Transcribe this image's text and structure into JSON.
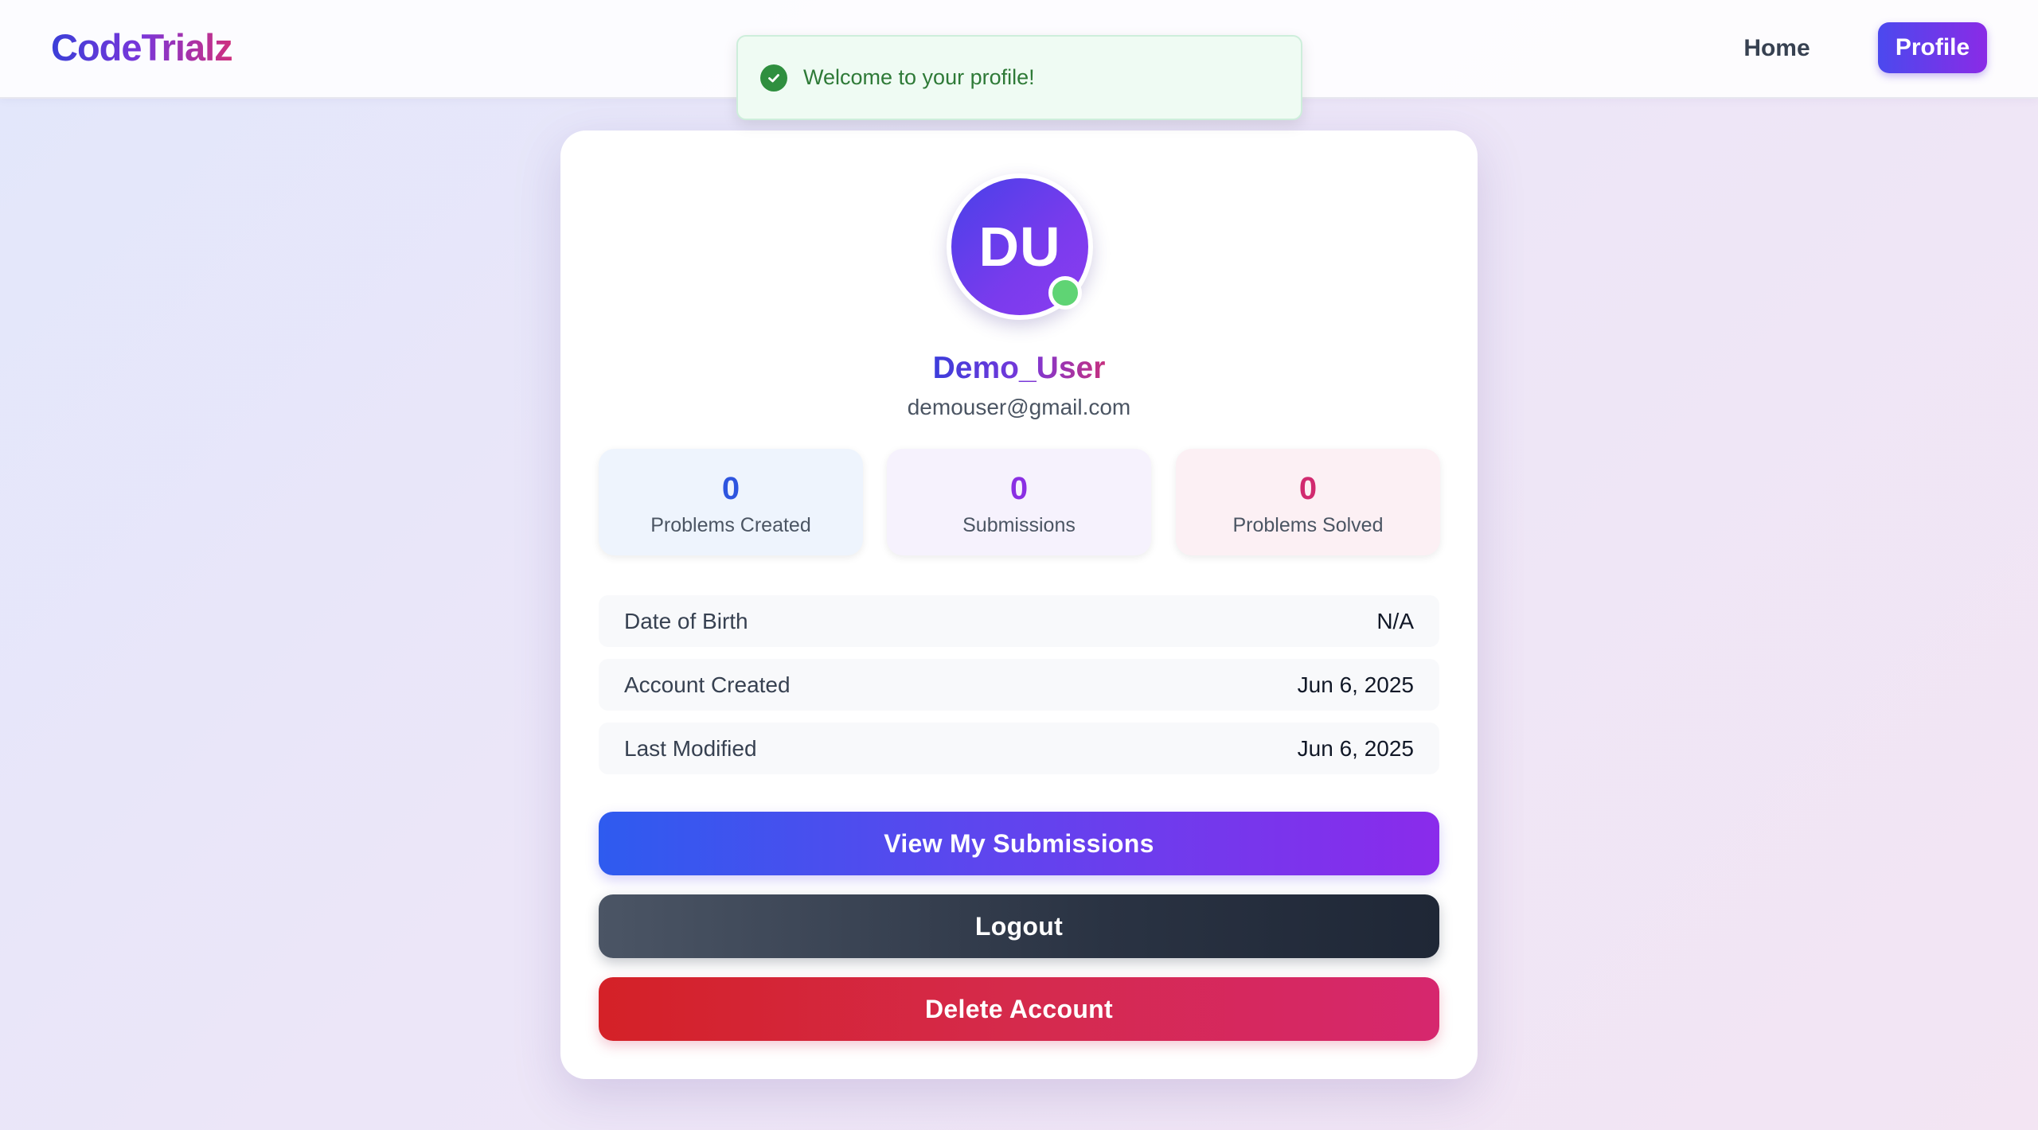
{
  "navbar": {
    "brand": "CodeTrialz",
    "home_label": "Home",
    "profile_label": "Profile"
  },
  "toast": {
    "message": "Welcome to your profile!",
    "icon": "check-circle-icon",
    "color": "#2f8f3f"
  },
  "profile": {
    "initials": "DU",
    "username": "Demo_User",
    "email": "demouser@gmail.com",
    "online_status_color": "#5fd474"
  },
  "stats": [
    {
      "value": "0",
      "label": "Problems Created",
      "color": "#2e55df"
    },
    {
      "value": "0",
      "label": "Submissions",
      "color": "#8a2fe3"
    },
    {
      "value": "0",
      "label": "Problems Solved",
      "color": "#d12a6f"
    }
  ],
  "info": [
    {
      "label": "Date of Birth",
      "value": "N/A"
    },
    {
      "label": "Account Created",
      "value": "Jun 6, 2025"
    },
    {
      "label": "Last Modified",
      "value": "Jun 6, 2025"
    }
  ],
  "actions": {
    "view_submissions": "View My Submissions",
    "logout": "Logout",
    "delete_account": "Delete Account"
  }
}
